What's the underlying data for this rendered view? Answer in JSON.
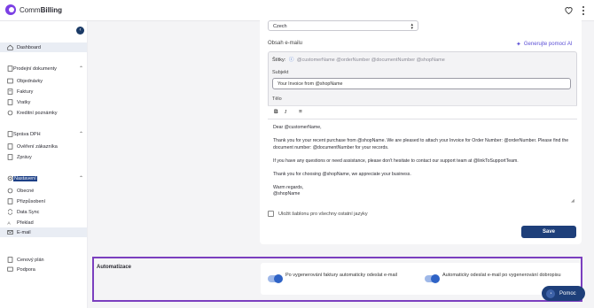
{
  "app": {
    "brand_light": "Comm",
    "brand_bold": "Billing"
  },
  "sidebar": {
    "collapse_glyph": "‹",
    "dashboard": "Dashboard",
    "sections": {
      "sales_docs": "Prodejní dokumenty",
      "vat": "Správa DPH",
      "settings": "Nastavení"
    },
    "items": {
      "orders": "Objednávky",
      "invoices": "Faktury",
      "returns": "Vratky",
      "credit_notes": "Kreditní poznámky",
      "customer_check": "Ověření zákazníka",
      "reports": "Zprávy",
      "general": "Obecné",
      "customization": "Přizpůsobení",
      "data_sync": "Data Sync",
      "translation": "Překlad",
      "email": "E-mail",
      "pricing": "Cenový plán",
      "support": "Podpora"
    }
  },
  "email_settings": {
    "language_value": "Czech",
    "section_title": "Obsah e-mailu",
    "ai_button": "Generujte pomocí AI",
    "tags_label": "Štítky:",
    "tags_values": "@customerName @orderNumber @documentNumber @shopName",
    "subject_label": "Subjekt",
    "subject_value": "Your Invoice from @shopName",
    "body_label": "Tělo",
    "toolbar": {
      "bold": "B",
      "italic": "I",
      "align": "≡"
    },
    "body": {
      "p1": "Dear @customerName,",
      "p2": "Thank you for your recent purchase from @shopName. We are pleased to attach your Invoice for Order Number: @orderNumber. Please find the document number: @documentNumber for your records.",
      "p3": "If you have any questions or need assistance, please don't hesitate to contact our support team at @linkToSupportTeam.",
      "p4": "Thank you for choosing @shopName, we appreciate your business.",
      "p5a": "Warm regards,",
      "p5b": "@shopName"
    },
    "save_template_label": "Uložit šablonu pro všechny ostatní jazyky",
    "save_button": "Save"
  },
  "automation": {
    "title": "Automatizace",
    "toggle1_label": "Po vygenerování faktury automaticky odeslat e-mail",
    "toggle1_on": true,
    "toggle2_label": "Automaticky odeslat e-mail po vygenerování dobropisu",
    "toggle2_on": true
  },
  "help": {
    "label": "Pomoc"
  },
  "colors": {
    "accent": "#1e3f7a",
    "brand": "#7b3fe4",
    "highlight_border": "#7b3fbf",
    "ai": "#5b4fd6"
  }
}
